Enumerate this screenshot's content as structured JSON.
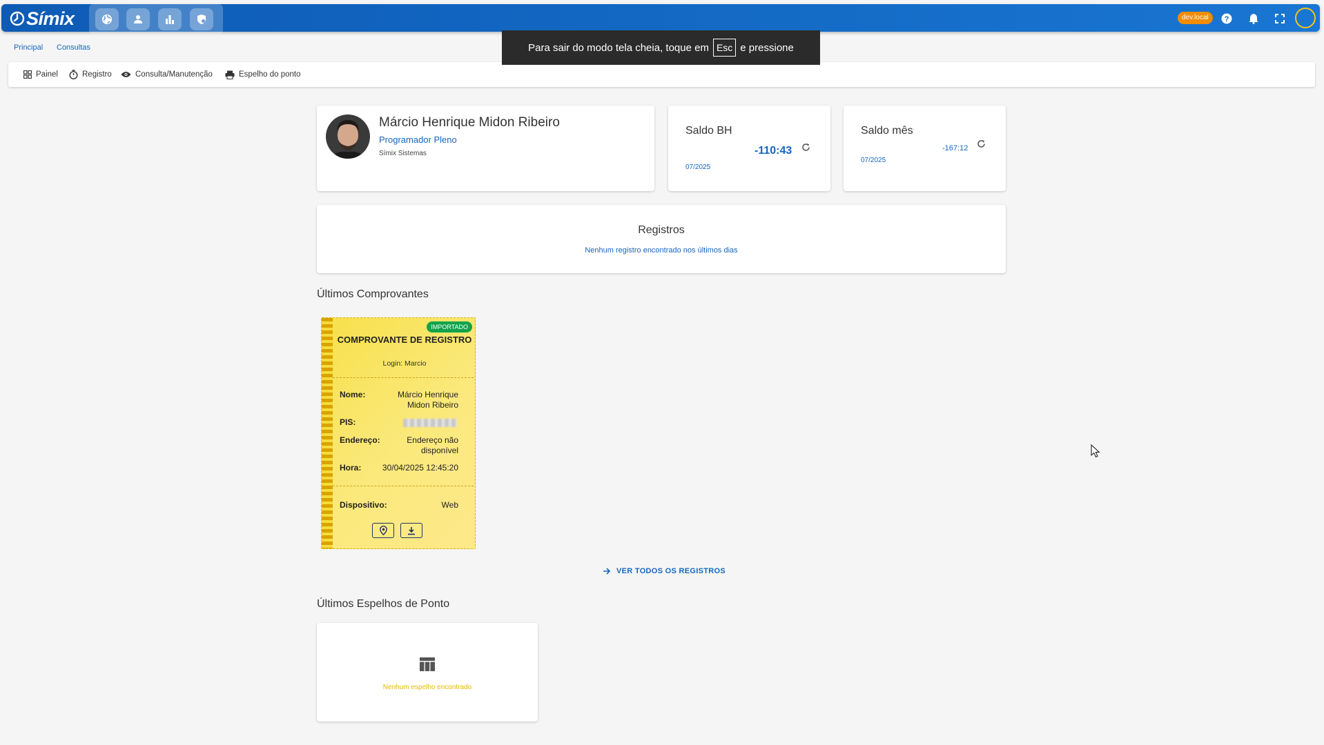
{
  "app": {
    "logo_text": "Símix",
    "env_badge": "dev.local"
  },
  "breadcrumb": [
    "Principal",
    "Consultas"
  ],
  "fullscreen_toast": {
    "before": "Para sair do modo tela cheia, toque em",
    "key": "Esc",
    "after": "e pressione"
  },
  "menu": [
    {
      "label": "Painel",
      "icon": "grid-icon"
    },
    {
      "label": "Registro",
      "icon": "stopwatch-icon"
    },
    {
      "label": "Consulta/Manutenção",
      "icon": "eye-icon"
    },
    {
      "label": "Espelho do ponto",
      "icon": "printer-icon"
    }
  ],
  "profile": {
    "name": "Márcio Henrique Midon Ribeiro",
    "role": "Programador Pleno",
    "company": "Símix Sistemas"
  },
  "saldo_bh": {
    "title": "Saldo BH",
    "value": "-110:43",
    "date": "07/2025"
  },
  "saldo_mes": {
    "title": "Saldo mês",
    "value": "-167:12",
    "date": "07/2025"
  },
  "registros": {
    "title": "Registros",
    "message": "Nenhum registro encontrado nos últimos dias"
  },
  "comprovantes": {
    "title": "Últimos Comprovantes",
    "receipt": {
      "badge": "IMPORTADO",
      "title": "COMPROVANTE DE REGISTRO",
      "login": "Login: Marcio",
      "nome_label": "Nome:",
      "nome": "Márcio Henrique Midon Ribeiro",
      "pis_label": "PIS:",
      "endereco_label": "Endereço:",
      "endereco": "Endereço não disponível",
      "hora_label": "Hora:",
      "hora": "30/04/2025 12:45:20",
      "dispositivo_label": "Dispositivo:",
      "dispositivo": "Web"
    },
    "ver_todos": "VER TODOS OS REGISTROS"
  },
  "espelhos": {
    "title": "Últimos Espelhos de Ponto",
    "message": "Nenhum espelho encontrado"
  },
  "colors": {
    "primary": "#1976d2",
    "accent_blue": "#1565c0",
    "receipt_yellow": "#f7e04a",
    "badge_green": "#13a34b",
    "env_orange": "#f28c00"
  }
}
